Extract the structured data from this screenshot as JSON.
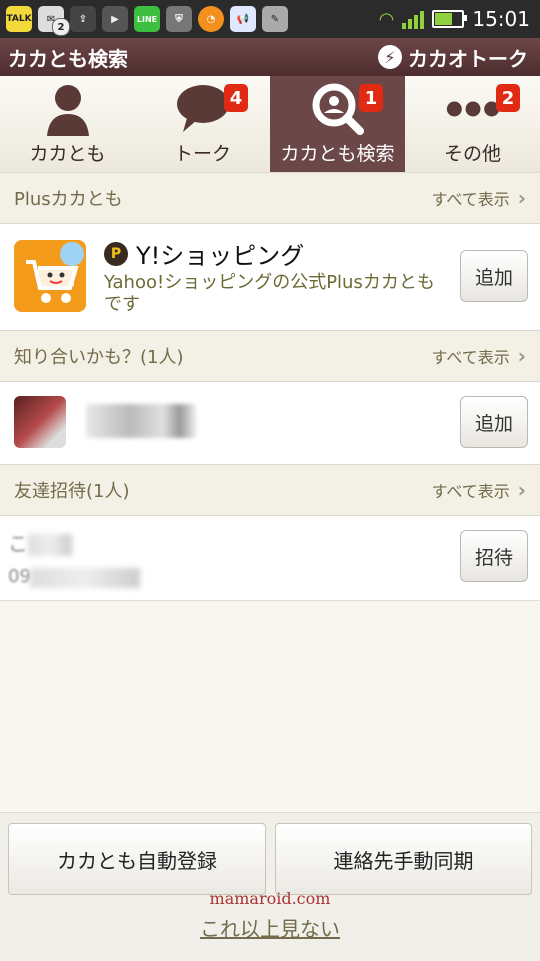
{
  "status_bar": {
    "talk_label": "TALK",
    "mail_count": "2",
    "line_label": "LINE",
    "time": "15:01"
  },
  "title_bar": {
    "title": "カカとも検索",
    "brand": "カカオトーク"
  },
  "tabs": [
    {
      "label": "カカとも",
      "icon": "person-icon",
      "badge": ""
    },
    {
      "label": "トーク",
      "icon": "speech-bubble-icon",
      "badge": "4"
    },
    {
      "label": "カカとも検索",
      "icon": "search-icon",
      "badge": "1",
      "active": true
    },
    {
      "label": "その他",
      "icon": "more-dots-icon",
      "badge": "2"
    }
  ],
  "plus_section": {
    "title": "Plusカカとも",
    "show_all": "すべて表示",
    "item": {
      "name": "Y!ショッピング",
      "description": "Yahoo!ショッピングの公式Plusカカともです",
      "button": "追加"
    }
  },
  "know_section": {
    "title": "知り合いかも？(1人)",
    "show_all": "すべて表示",
    "button": "追加"
  },
  "invite_section": {
    "title": "友達招待(1人)",
    "show_all": "すべて表示",
    "name_partial": "こ",
    "phone_partial": "09",
    "button": "招待"
  },
  "bottom": {
    "auto_register": "カカとも自動登録",
    "manual_sync": "連絡先手動同期",
    "watermark": "mamaroid.com",
    "no_more": "これ以上見ない"
  },
  "colors": {
    "title_bar": "#5a3537",
    "badge": "#e02a14",
    "section_text": "#746b4c",
    "active_tab": "#6b4748"
  }
}
